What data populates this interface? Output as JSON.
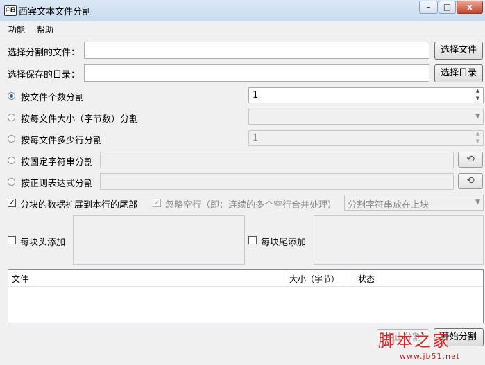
{
  "window": {
    "title": "西宾文本文件分割",
    "icon_text": "ᗩᗷ",
    "minimize": "–",
    "maximize": "□",
    "close": "x"
  },
  "menu": [
    "功能",
    "帮助"
  ],
  "file_row": {
    "label": "选择分割的文件：",
    "value": "",
    "button": "选择文件"
  },
  "dir_row": {
    "label": "选择保存的目录：",
    "value": "",
    "button": "选择目录"
  },
  "options": {
    "by_count": {
      "label": "按文件个数分割",
      "checked": true,
      "value": "1"
    },
    "by_size": {
      "label": "按每文件大小（字节数）分割",
      "checked": false,
      "value": ""
    },
    "by_lines": {
      "label": "按每文件多少行分割",
      "checked": false,
      "value": "1"
    },
    "by_string": {
      "label": "按固定字符串分割",
      "checked": false,
      "value": ""
    },
    "by_regex": {
      "label": "按正则表达式分割",
      "checked": false,
      "value": ""
    }
  },
  "extend_row": {
    "extend_label": "分块的数据扩展到本行的尾部",
    "extend_checked": true,
    "ignore_label": "忽略空行（即：连续的多个空行合并处理）",
    "ignore_checked": true,
    "position_value": "分割字符串放在上块"
  },
  "header_add": {
    "label": "每块头添加",
    "checked": false,
    "value": ""
  },
  "footer_add": {
    "label": "每块尾添加",
    "checked": false,
    "value": ""
  },
  "table": {
    "columns": [
      "文件",
      "大小（字节）",
      "状态"
    ],
    "rows": []
  },
  "actions": {
    "stop": "中止分割",
    "start": "开始分割"
  },
  "watermark": {
    "text": "脚本之家",
    "url": "www.jb51.net"
  },
  "icons": {
    "history": "history-icon"
  }
}
